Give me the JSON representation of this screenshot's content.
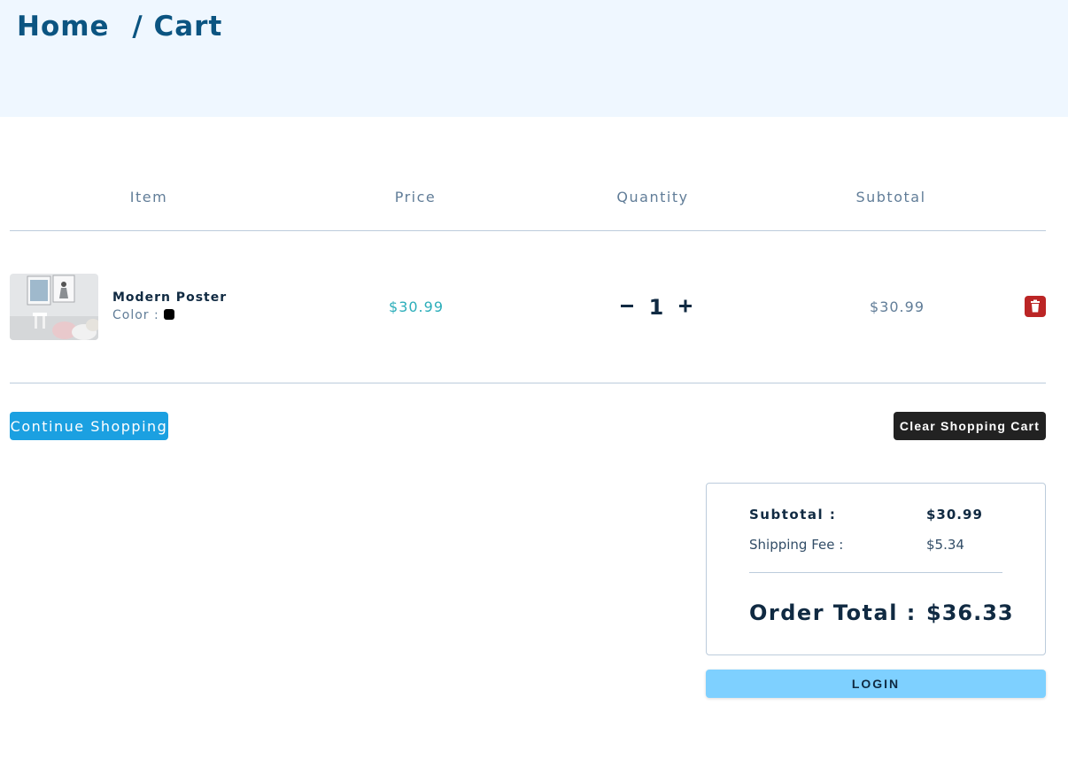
{
  "breadcrumb": {
    "home": "Home",
    "separator": "/",
    "current": "Cart"
  },
  "table_headers": [
    "Item",
    "Price",
    "Quantity",
    "Subtotal"
  ],
  "cart_items": [
    {
      "name": "Modern Poster",
      "color_label": "Color :",
      "color": "#000000",
      "price": "$30.99",
      "quantity": "1",
      "subtotal": "$30.99",
      "decrease_icon": "minus-icon",
      "increase_icon": "plus-icon",
      "remove_icon": "trash-icon"
    }
  ],
  "actions": {
    "continue_label": "Continue Shopping",
    "clear_label": "Clear Shopping Cart"
  },
  "totals": {
    "subtotal_label": "Subtotal :",
    "subtotal_value": "$30.99",
    "shipping_label": "Shipping Fee :",
    "shipping_value": "$5.34",
    "order_total_label": "Order Total :",
    "order_total_value": "$36.33"
  },
  "login_label": "LOGIN",
  "colors": {
    "brand_dark": "#0b5481",
    "hero_bg": "#eff7ff",
    "price_accent": "#2caeba",
    "continue_button": "#1ba0e1",
    "clear_button": "#222222",
    "remove_button": "#bb2525",
    "login_button": "#7ed0ff"
  }
}
